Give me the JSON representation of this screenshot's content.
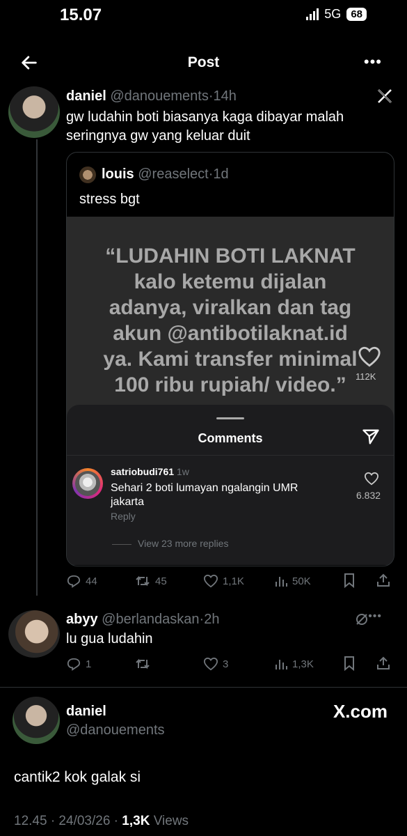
{
  "status_bar": {
    "time": "15.07",
    "network": "5G",
    "battery": "68"
  },
  "header": {
    "title": "Post"
  },
  "tweet1": {
    "name": "daniel",
    "handle": "@danouements",
    "time": "14h",
    "text_line1": "gw ludahin boti biasanya kaga dibayar malah",
    "text_line2": "seringnya gw yang keluar duit",
    "quote": {
      "name": "louis",
      "handle": "@reaselect",
      "time": "1d",
      "text": "stress bgt",
      "image": {
        "lines": [
          "“LUDAHIN BOTI LAKNAT",
          "kalo ketemu dijalan",
          "adanya, viralkan dan tag",
          "akun @antibotilaknat.id",
          "ya. Kami transfer minimal",
          "100 ribu rupiah/ video.”"
        ],
        "like_count": "112K",
        "comments_title": "Comments",
        "comment": {
          "user": "satriobudi761",
          "time": "1w",
          "text_line1": "Sehari 2 boti lumayan ngalangin UMR",
          "text_line2": "jakarta",
          "likes": "6.832",
          "reply": "Reply",
          "view_more": "View 23 more replies"
        }
      }
    },
    "stats": {
      "replies": "44",
      "reposts": "45",
      "likes": "1,1K",
      "views": "50K"
    }
  },
  "tweet2": {
    "name": "abyy",
    "handle": "@berlandaskan",
    "time": "2h",
    "text": "lu gua ludahin",
    "stats": {
      "replies": "1",
      "likes": "3",
      "views": "1,3K"
    }
  },
  "main_tweet": {
    "name": "daniel",
    "handle": "@danouements",
    "brand": "X.com",
    "text": "cantik2 kok galak si",
    "meta_time": "12.45 · 24/03/26 · ",
    "meta_views_count": "1,3K",
    "meta_views_label": " Views"
  }
}
